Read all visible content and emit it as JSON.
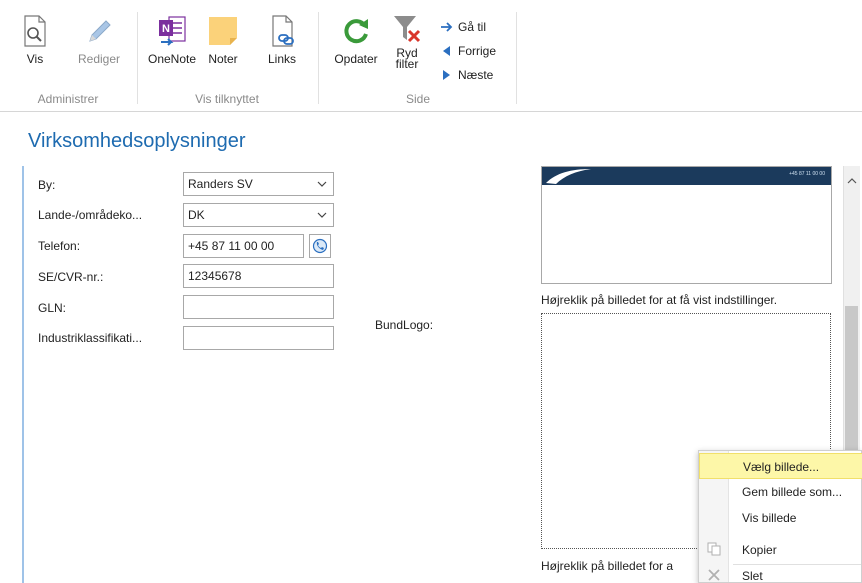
{
  "ribbon": {
    "groups": [
      {
        "label": "Administrer",
        "buttons": [
          {
            "label": "Vis",
            "icon": "view-doc-icon"
          },
          {
            "label": "Rediger",
            "icon": "pencil-icon"
          }
        ]
      },
      {
        "label": "Vis tilknyttet",
        "buttons": [
          {
            "label": "OneNote",
            "icon": "onenote-icon"
          },
          {
            "label": "Noter",
            "icon": "note-icon"
          },
          {
            "label": "Links",
            "icon": "link-doc-icon"
          }
        ]
      },
      {
        "label": "Side",
        "buttons": [
          {
            "label": "Opdater",
            "icon": "refresh-icon"
          },
          {
            "label": "Ryd filter",
            "icon": "clear-filter-icon"
          }
        ],
        "nav": [
          {
            "label": "Gå til",
            "icon": "arrow-right-icon"
          },
          {
            "label": "Forrige",
            "icon": "triangle-left-icon"
          },
          {
            "label": "Næste",
            "icon": "triangle-right-icon"
          }
        ]
      }
    ]
  },
  "page": {
    "title": "Virksomhedsoplysninger",
    "fields": [
      {
        "label": "By:",
        "value": "Randers SV",
        "type": "select"
      },
      {
        "label": "Lande-/områdeko...",
        "value": "DK",
        "type": "select"
      },
      {
        "label": "Telefon:",
        "value": "+45 87 11 00 00",
        "type": "text"
      },
      {
        "label": "SE/CVR-nr.:",
        "value": "12345678",
        "type": "text"
      },
      {
        "label": "GLN:",
        "value": "",
        "type": "text"
      },
      {
        "label": "Industriklassifikati...",
        "value": "",
        "type": "text"
      }
    ],
    "bundlogo_label": "BundLogo:",
    "hint_top": "Højreklik på billedet for at få vist indstillinger.",
    "hint_bottom": "Højreklik på billedet for a",
    "logo_strip_text": "+45 87 11 00 00"
  },
  "context_menu": {
    "items": [
      {
        "label": "Vælg billede...",
        "highlighted": true
      },
      {
        "label": "Gem billede som..."
      },
      {
        "label": "Vis billede"
      },
      {
        "label": "Kopier",
        "icon": "copy-icon"
      },
      {
        "label": "Slet",
        "icon": "delete-x-icon"
      }
    ]
  },
  "colors": {
    "accent": "#1e6bb0",
    "highlight": "#fdf7a8",
    "onenote": "#7b2f9e",
    "refresh": "#3a9a3a"
  }
}
